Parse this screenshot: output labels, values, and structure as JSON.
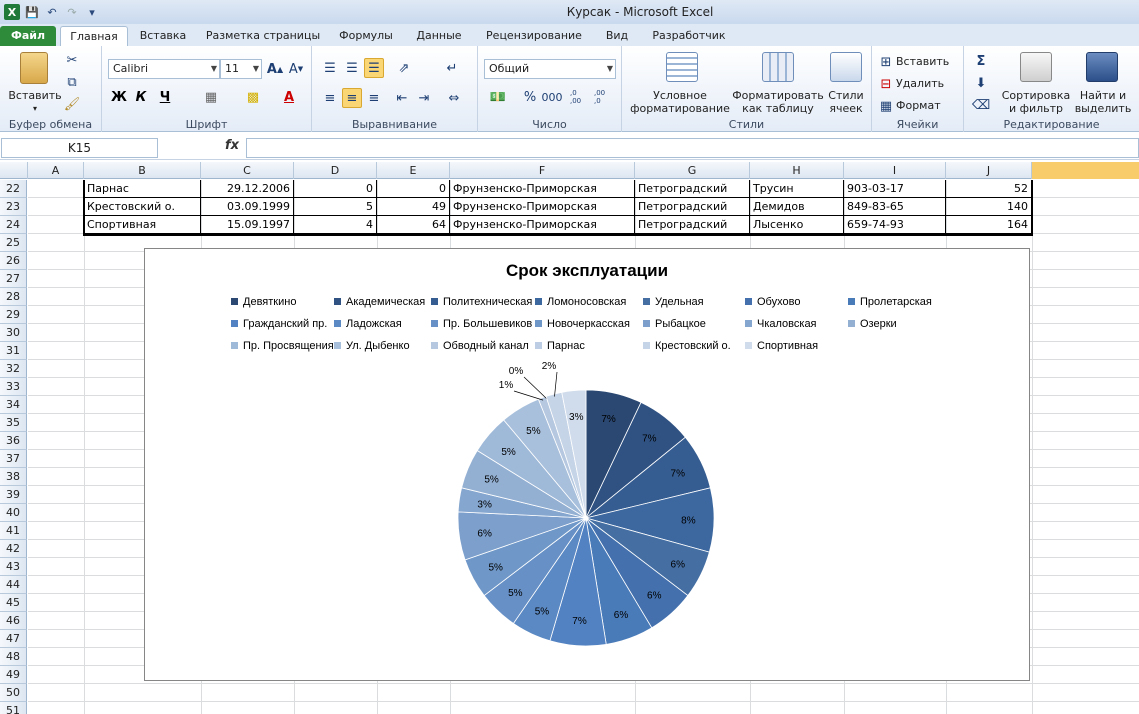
{
  "window": {
    "title": "Курсак  -  Microsoft Excel"
  },
  "tabs": [
    {
      "label": "Файл"
    },
    {
      "label": "Главная"
    },
    {
      "label": "Вставка"
    },
    {
      "label": "Разметка страницы"
    },
    {
      "label": "Формулы"
    },
    {
      "label": "Данные"
    },
    {
      "label": "Рецензирование"
    },
    {
      "label": "Вид"
    },
    {
      "label": "Разработчик"
    }
  ],
  "ribbon": {
    "clipboard": {
      "label": "Буфер обмена",
      "paste": "Вставить"
    },
    "font": {
      "label": "Шрифт",
      "font_name": "Calibri",
      "font_size": "11",
      "bold": "Ж",
      "italic": "К",
      "underline": "Ч"
    },
    "alignment": {
      "label": "Выравнивание"
    },
    "number": {
      "label": "Число",
      "format": "Общий",
      "percent": "%",
      "thousands": "000",
      "inc": ",0 ,00",
      "dec": ",00 ,0"
    },
    "styles": {
      "label": "Стили",
      "conditional": "Условное",
      "conditional2": "форматирование",
      "table": "Форматировать",
      "table2": "как таблицу",
      "cell": "Стили",
      "cell2": "ячеек"
    },
    "cells": {
      "label": "Ячейки",
      "insert": "Вставить",
      "delete": "Удалить",
      "format": "Формат"
    },
    "editing": {
      "label": "Редактирование",
      "sort": "Сортировка",
      "sort2": "и фильтр",
      "find": "Найти и",
      "find2": "выделить"
    }
  },
  "formula_bar": {
    "name_box": "K15",
    "fx": "fx",
    "formula": ""
  },
  "columns": [
    "A",
    "B",
    "C",
    "D",
    "E",
    "F",
    "G",
    "H",
    "I",
    "J"
  ],
  "rows": [
    "22",
    "23",
    "24",
    "25",
    "26",
    "27",
    "28",
    "29",
    "30",
    "31",
    "32",
    "33",
    "34",
    "35",
    "36",
    "37",
    "38",
    "39",
    "40",
    "41",
    "42",
    "43",
    "44",
    "45",
    "46",
    "47",
    "48",
    "49",
    "50",
    "51"
  ],
  "table": [
    [
      "Парнас",
      "29.12.2006",
      "0",
      "0",
      "Фрунзенско-Приморская",
      "Петроградский",
      "Трусин",
      "903-03-17",
      "52"
    ],
    [
      "Крестовский о.",
      "03.09.1999",
      "5",
      "49",
      "Фрунзенско-Приморская",
      "Петроградский",
      "Демидов",
      "849-83-65",
      "140"
    ],
    [
      "Спортивная",
      "15.09.1997",
      "4",
      "64",
      "Фрунзенско-Приморская",
      "Петроградский",
      "Лысенко",
      "659-74-93",
      "164"
    ]
  ],
  "chart_data": {
    "type": "pie",
    "title": "Срок эксплуатации",
    "legend_position": "top",
    "categories": [
      "Девяткино",
      "Академическая",
      "Политехническая",
      "Ломоносовская",
      "Удельная",
      "Обухово",
      "Пролетарская",
      "Гражданский пр.",
      "Ладожская",
      "Пр. Большевиков",
      "Новочеркасская",
      "Рыбацкое",
      "Чкаловская",
      "Озерки",
      "Пр. Просвящения",
      "Ул. Дыбенко",
      "Обводный канал",
      "Парнас",
      "Крестовский о.",
      "Спортивная"
    ],
    "values": [
      7,
      7,
      7,
      8,
      6,
      6,
      6,
      7,
      5,
      5,
      5,
      6,
      3,
      5,
      5,
      5,
      1,
      0,
      2,
      3
    ],
    "labels": [
      "7%",
      "7%",
      "7%",
      "8%",
      "6%",
      "6%",
      "6%",
      "7%",
      "5%",
      "5%",
      "5%",
      "6%",
      "3%",
      "5%",
      "5%",
      "5%",
      "1%",
      "0%",
      "2%",
      "3%"
    ],
    "colors": [
      "#2a4872",
      "#2f5283",
      "#365d91",
      "#3c679f",
      "#456fa3",
      "#4471ad",
      "#4a7bb9",
      "#5282c2",
      "#5b89c3",
      "#6791c6",
      "#6f98c8",
      "#7c9fcc",
      "#85a6cf",
      "#93b0d3",
      "#9fb9d9",
      "#a9c0dc",
      "#b5c8e0",
      "#bdcee4",
      "#c6d4e7",
      "#d0dcec"
    ]
  }
}
